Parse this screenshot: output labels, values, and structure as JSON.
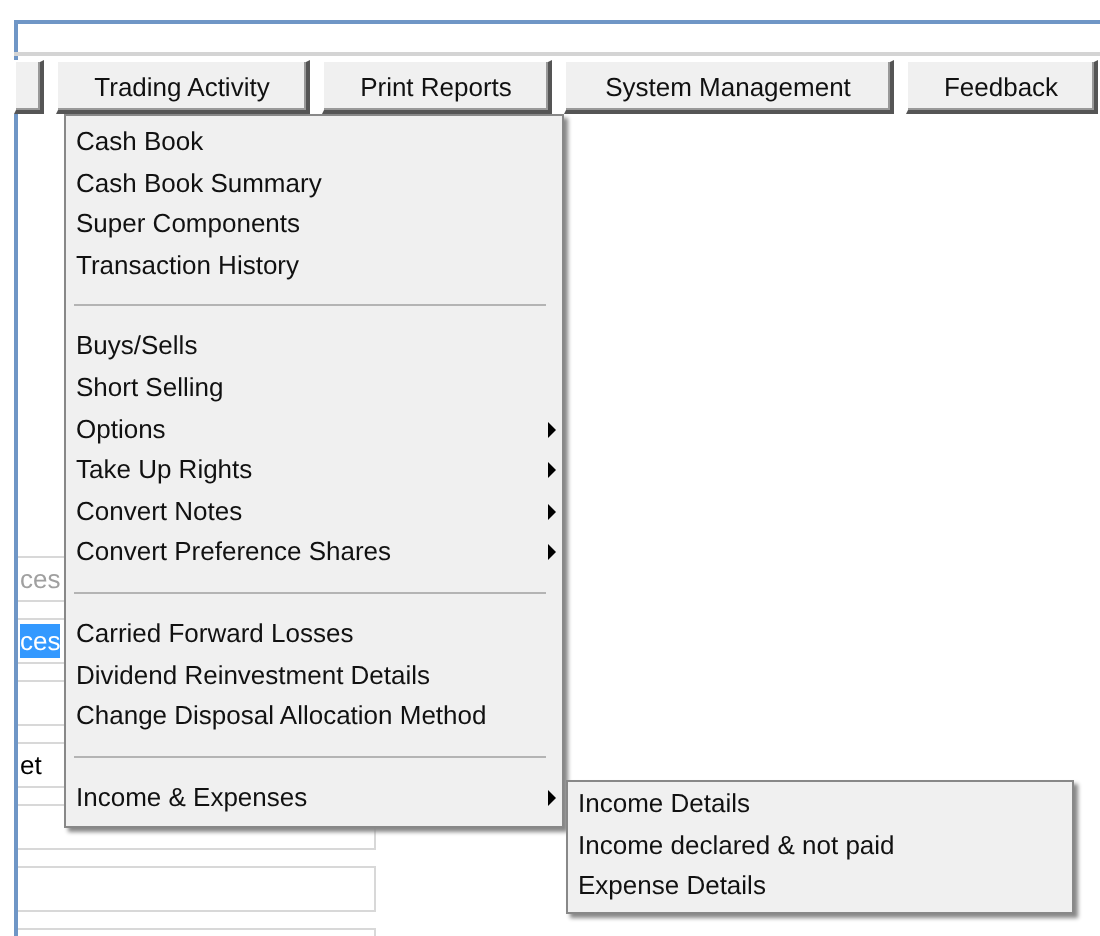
{
  "menu_bar": [
    {
      "kind": "cut"
    },
    {
      "kind": "button",
      "label": "Trading Activity"
    },
    {
      "kind": "button",
      "label": "Print Reports"
    },
    {
      "kind": "button",
      "label": "System Management"
    },
    {
      "kind": "button",
      "label": "Feedback"
    }
  ],
  "left_fields": [
    {
      "kind": "text",
      "placeholder": "ces"
    },
    {
      "kind": "text",
      "value": "ces",
      "text_selected": true
    },
    {
      "kind": "empty"
    },
    {
      "kind": "text",
      "value": "et"
    },
    {
      "kind": "empty"
    },
    {
      "kind": "empty"
    },
    {
      "kind": "empty"
    }
  ],
  "menu": {
    "items": [
      {
        "kind": "item",
        "label": "Cash Book",
        "submenu": false
      },
      {
        "kind": "item",
        "label": "Cash Book Summary",
        "submenu": false
      },
      {
        "kind": "item",
        "label": "Super Components",
        "submenu": false
      },
      {
        "kind": "item",
        "label": "Transaction History",
        "submenu": false
      },
      {
        "kind": "separator"
      },
      {
        "kind": "item",
        "label": "Buys/Sells",
        "submenu": false
      },
      {
        "kind": "item",
        "label": "Short Selling",
        "submenu": false
      },
      {
        "kind": "item",
        "label": "Options",
        "submenu": true
      },
      {
        "kind": "item",
        "label": "Take Up Rights",
        "submenu": true
      },
      {
        "kind": "item",
        "label": "Convert Notes",
        "submenu": true
      },
      {
        "kind": "item",
        "label": "Convert Preference Shares",
        "submenu": true
      },
      {
        "kind": "separator"
      },
      {
        "kind": "item",
        "label": "Carried Forward Losses",
        "submenu": false
      },
      {
        "kind": "item",
        "label": "Dividend Reinvestment Details",
        "submenu": false
      },
      {
        "kind": "item",
        "label": "Change Disposal Allocation Method",
        "submenu": false
      },
      {
        "kind": "separator"
      },
      {
        "kind": "item",
        "label": "Income & Expenses",
        "submenu": true,
        "expanded": true,
        "children": [
          {
            "label": "Income Details"
          },
          {
            "label": "Income declared & not paid"
          },
          {
            "label": "Expense Details"
          }
        ]
      }
    ]
  }
}
